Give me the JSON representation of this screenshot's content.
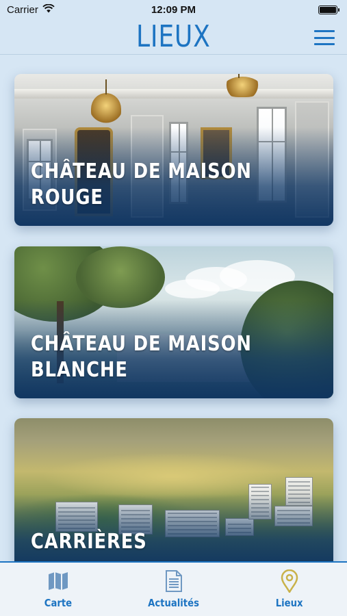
{
  "status_bar": {
    "carrier": "Carrier",
    "time": "12:09 PM"
  },
  "header": {
    "title": "LIEUX",
    "menu_icon": "hamburger-menu-icon"
  },
  "places": [
    {
      "title": "CHÂTEAU DE MAISON ROUGE"
    },
    {
      "title": "CHÂTEAU DE MAISON BLANCHE"
    },
    {
      "title": "CARRIÈRES"
    }
  ],
  "tabs": [
    {
      "label": "Carte",
      "icon": "map-icon"
    },
    {
      "label": "Actualités",
      "icon": "document-icon"
    },
    {
      "label": "Lieux",
      "icon": "location-pin-icon",
      "active": true
    }
  ],
  "colors": {
    "accent": "#1d74c2",
    "background": "#d6e6f4",
    "tab_bar": "#eef3f8",
    "pin_active": "#c9b24a"
  }
}
